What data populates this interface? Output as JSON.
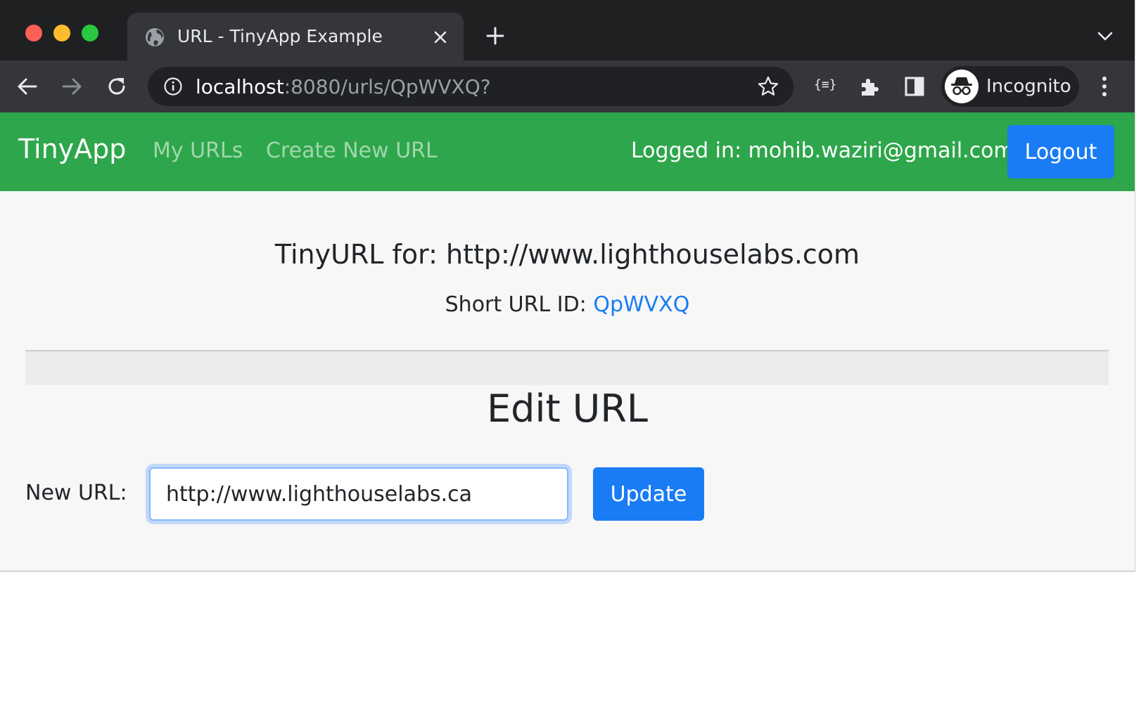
{
  "browser": {
    "tab_title": "URL - TinyApp Example",
    "tab_icon": "globe-icon",
    "url_host": "localhost",
    "url_path": ":8080/urls/QpWVXQ?",
    "profile_label": "Incognito",
    "extension_label": "{≡}",
    "colors": {
      "frame": "#1f2022",
      "toolbar": "#35363a",
      "omnibox": "#202124"
    }
  },
  "nav": {
    "brand": "TinyApp",
    "links": [
      "My URLs",
      "Create New URL"
    ],
    "logged_in_text": "Logged in: mohib.waziri@gmail.com",
    "logout_label": "Logout",
    "colors": {
      "navbar": "#2ea64b",
      "button": "#1a7cf5"
    }
  },
  "main": {
    "title": "TinyURL for: http://www.lighthouselabs.com",
    "short_id_label": "Short URL ID: ",
    "short_id": "QpWVXQ",
    "edit_heading": "Edit URL",
    "new_url_label": "New URL:",
    "new_url_value": "http://www.lighthouselabs.ca",
    "update_label": "Update"
  }
}
